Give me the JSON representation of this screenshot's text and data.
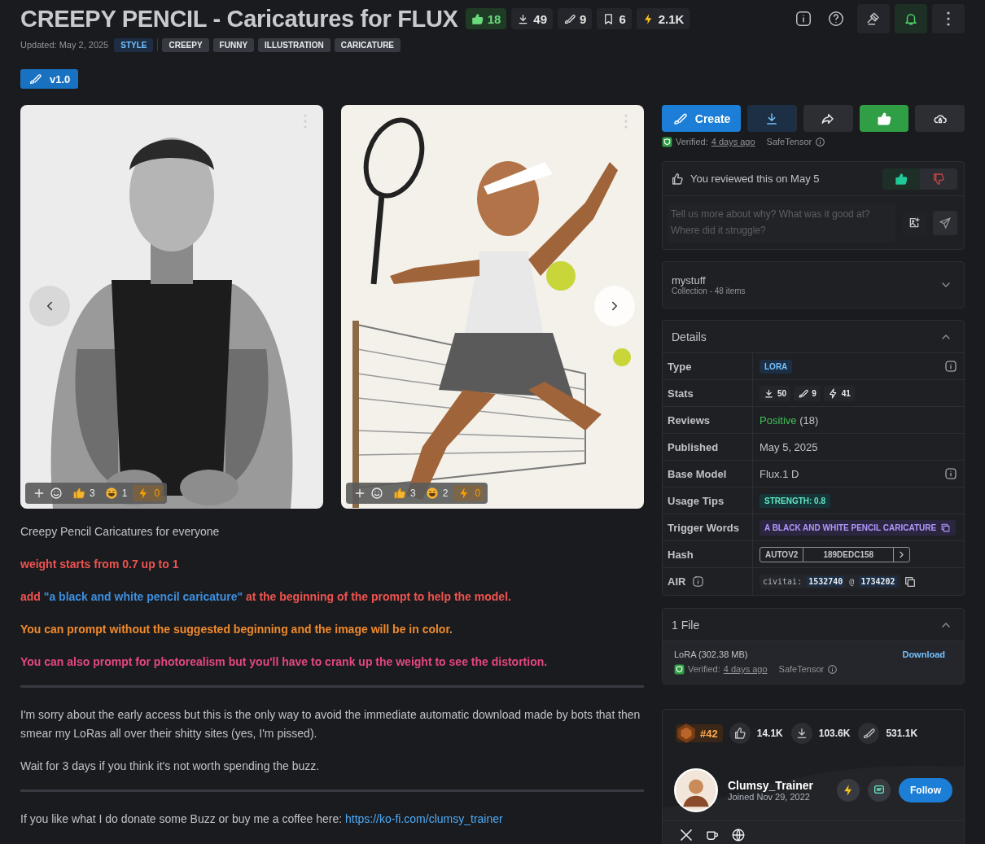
{
  "header": {
    "title": "CREEPY PENCIL - Caricatures for FLUX",
    "notifications_on": true,
    "stats": [
      {
        "value": "18",
        "selected": true
      },
      {
        "value": "49",
        "selected": false
      },
      {
        "value": "9",
        "selected": false
      },
      {
        "value": "6",
        "selected": false
      },
      {
        "value": "2.1K",
        "selected": false
      }
    ],
    "updated": "Updated: May 2, 2025",
    "category": "STYLE",
    "tags": [
      "CREEPY",
      "FUNNY",
      "ILLUSTRATION",
      "CARICATURE"
    ]
  },
  "versions": [
    {
      "label": "v1.0",
      "selected": true
    }
  ],
  "gallery": [
    {
      "kind": "picture",
      "reactions": [
        "3",
        "1",
        "0"
      ]
    },
    {
      "kind": "picture",
      "reactions": [
        "3",
        "2",
        "0"
      ]
    }
  ],
  "description": [
    {
      "kind": "plain",
      "segments": [
        {
          "text": "Creepy Pencil Caricatures for everyone"
        }
      ]
    },
    {
      "kind": "bold",
      "segments": [
        {
          "text": "weight starts from 0.7 up to 1",
          "color": "#ef5350"
        }
      ]
    },
    {
      "kind": "bold",
      "segments": [
        {
          "text": "add ",
          "color": "#ef5350"
        },
        {
          "text": "\"a black and white pencil caricature\"",
          "color": "#3d8fe0"
        },
        {
          "text": " at the beginning of the prompt to help the model.",
          "color": "#ef5350"
        }
      ]
    },
    {
      "kind": "bold",
      "segments": [
        {
          "text": "You can prompt without the suggested beginning and the image will be in color.",
          "color": "#f08a2c"
        }
      ]
    },
    {
      "kind": "bold",
      "segments": [
        {
          "text": "You can also prompt for photorealism but you'll have to crank up the weight to see the distortion.",
          "color": "#e4477f"
        }
      ]
    },
    {
      "kind": "divider"
    },
    {
      "kind": "plain",
      "segments": [
        {
          "text": "I'm sorry about the early access but this is the only way to avoid the immediate automatic download made by bots that then smear my LoRas all over their shitty sites (yes, I'm pissed)."
        }
      ]
    },
    {
      "kind": "plain",
      "segments": [
        {
          "text": "Wait for 3 days if you think it's not worth spending the buzz."
        }
      ]
    },
    {
      "kind": "divider"
    },
    {
      "kind": "plain",
      "segments": [
        {
          "text": "If you like what I do donate some Buzz or buy me a coffee here: "
        },
        {
          "text": "https://ko-fi.com/clumsy_trainer",
          "link": true
        }
      ]
    }
  ],
  "actions": {
    "create": "Create",
    "liked": true
  },
  "verification": {
    "label": "Verified:",
    "when": "4 days ago",
    "format": "SafeTensor"
  },
  "review": {
    "text": "You reviewed this on May 5",
    "liked": true,
    "disliked": false,
    "placeholder": "Tell us more about why? What was it good at? Where did it struggle?"
  },
  "collection": {
    "name": "mystuff",
    "subtitle": "Collection - 48 items",
    "expanded": false
  },
  "details": {
    "title": "Details",
    "expanded": true,
    "rows": [
      {
        "label": "Type",
        "kind": "badge",
        "value": "LORA",
        "info": true
      },
      {
        "label": "Stats",
        "kind": "stats",
        "values": [
          "50",
          "9",
          "41"
        ],
        "info": false
      },
      {
        "label": "Reviews",
        "kind": "reviews",
        "value": "Positive",
        "count": "(18)",
        "info": false
      },
      {
        "label": "Published",
        "kind": "text",
        "value": "May 5, 2025",
        "info": false
      },
      {
        "label": "Base Model",
        "kind": "text",
        "value": "Flux.1 D",
        "info": true
      },
      {
        "label": "Usage Tips",
        "kind": "tip",
        "value": "STRENGTH: 0.8",
        "info": false
      },
      {
        "label": "Trigger Words",
        "kind": "trigger",
        "value": "A BLACK AND WHITE PENCIL CARICATURE",
        "info": false
      },
      {
        "label": "Hash",
        "kind": "hash",
        "type": "AUTOV2",
        "value": "189DEDC158",
        "info": false
      },
      {
        "label": "AIR",
        "kind": "air",
        "prefix": "civitai:",
        "model": "1532740",
        "sep": "@",
        "version": "1734202",
        "info": true
      }
    ]
  },
  "files": {
    "title": "1 File",
    "expanded": true,
    "items": [
      {
        "name": "LoRA (302.38 MB)",
        "action": "Download",
        "verified": "Verified:",
        "when": "4 days ago",
        "format": "SafeTensor"
      }
    ]
  },
  "creator": {
    "rank": "#42",
    "stats": [
      "14.1K",
      "103.6K",
      "531.1K"
    ],
    "name": "Clumsy_Trainer",
    "joined": "Joined Nov 29, 2022",
    "follow": "Follow"
  }
}
